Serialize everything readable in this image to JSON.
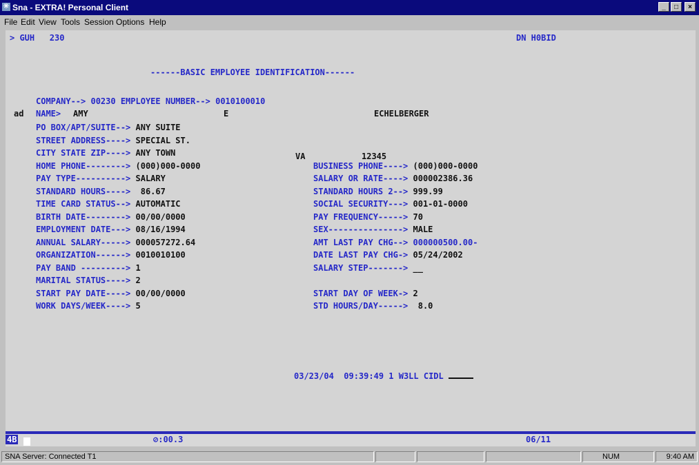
{
  "window": {
    "title": "Sna - EXTRA! Personal Client",
    "controls": [
      "_",
      "□",
      "×"
    ]
  },
  "menu": [
    "File",
    "Edit",
    "View",
    "Tools",
    "Session",
    "Options",
    "Help"
  ],
  "screen": {
    "command_prompt": "> GUH   230",
    "system_id": "DN H0BID",
    "heading": "------BASIC EMPLOYEE IDENTIFICATION------",
    "company_label": "COMPANY--> ",
    "company_value": "00230",
    "empnum_label": " EMPLOYEE NUMBER--> ",
    "empnum_value": "0010100010",
    "ad_flag": "ad",
    "name_label": "NAME>",
    "first_name": "AMY",
    "middle_initial": "E",
    "last_name": "ECHELBERGER",
    "left_fields": [
      {
        "label": "PO BOX/APT/SUITE--> ",
        "value": "ANY SUITE"
      },
      {
        "label": "STREET ADDRESS----> ",
        "value": "SPECIAL ST."
      },
      {
        "label": "CITY STATE ZIP----> ",
        "value": "ANY TOWN"
      },
      {
        "label": "HOME PHONE--------> ",
        "value": "(000)000-0000"
      },
      {
        "label": "PAY TYPE----------> ",
        "value": "SALARY"
      },
      {
        "label": "STANDARD HOURS----> ",
        "value": " 86.67"
      },
      {
        "label": "TIME CARD STATUS--> ",
        "value": "AUTOMATIC"
      },
      {
        "label": "BIRTH DATE--------> ",
        "value": "00/00/0000"
      },
      {
        "label": "EMPLOYMENT DATE---> ",
        "value": "08/16/1994"
      },
      {
        "label": "ANNUAL SALARY-----> ",
        "value": "000057272.64"
      },
      {
        "label": "ORGANIZATION------> ",
        "value": "0010010100"
      },
      {
        "label": "PAY BAND ---------> ",
        "value": "1"
      },
      {
        "label": "MARITAL STATUS----> ",
        "value": "2"
      },
      {
        "label": "START PAY DATE----> ",
        "value": "00/00/0000"
      },
      {
        "label": "WORK DAYS/WEEK----> ",
        "value": "5"
      }
    ],
    "state": "VA",
    "zip": "12345",
    "right_fields": [
      {
        "label": "BUSINESS PHONE----> ",
        "value": "(000)000-0000",
        "value_color": "k"
      },
      {
        "label": "SALARY OR RATE----> ",
        "value": "000002386.36",
        "value_color": "k"
      },
      {
        "label": "STANDARD HOURS 2--> ",
        "value": "999.99",
        "value_color": "k"
      },
      {
        "label": "SOCIAL SECURITY---> ",
        "value": "001-01-0000",
        "value_color": "k"
      },
      {
        "label": "PAY FREQUENCY-----> ",
        "value": "70",
        "value_color": "k"
      },
      {
        "label": "SEX---------------> ",
        "value": "MALE",
        "value_color": "k"
      },
      {
        "label": "AMT LAST PAY CHG--> ",
        "value": "000000500.00-",
        "value_color": "b"
      },
      {
        "label": "DATE LAST PAY CHG-> ",
        "value": "05/24/2002",
        "value_color": "k"
      },
      {
        "label": "SALARY STEP-------> ",
        "value": "__",
        "value_color": "k"
      },
      {
        "label": "",
        "value": "",
        "value_color": "k"
      },
      {
        "label": "START DAY OF WEEK-> ",
        "value": "2",
        "value_color": "k"
      },
      {
        "label": "STD HOURS/DAY-----> ",
        "value": " 8.0",
        "value_color": "k"
      }
    ],
    "footer_line": "03/23/04  09:39:49 1 W3LL CIDL"
  },
  "oia": {
    "left": "4B",
    "mid": "⊘:00.3",
    "pos": "06/11"
  },
  "statusbar": {
    "server": "SNA Server: Connected T1",
    "num": "NUM",
    "time": "9:40 AM"
  }
}
